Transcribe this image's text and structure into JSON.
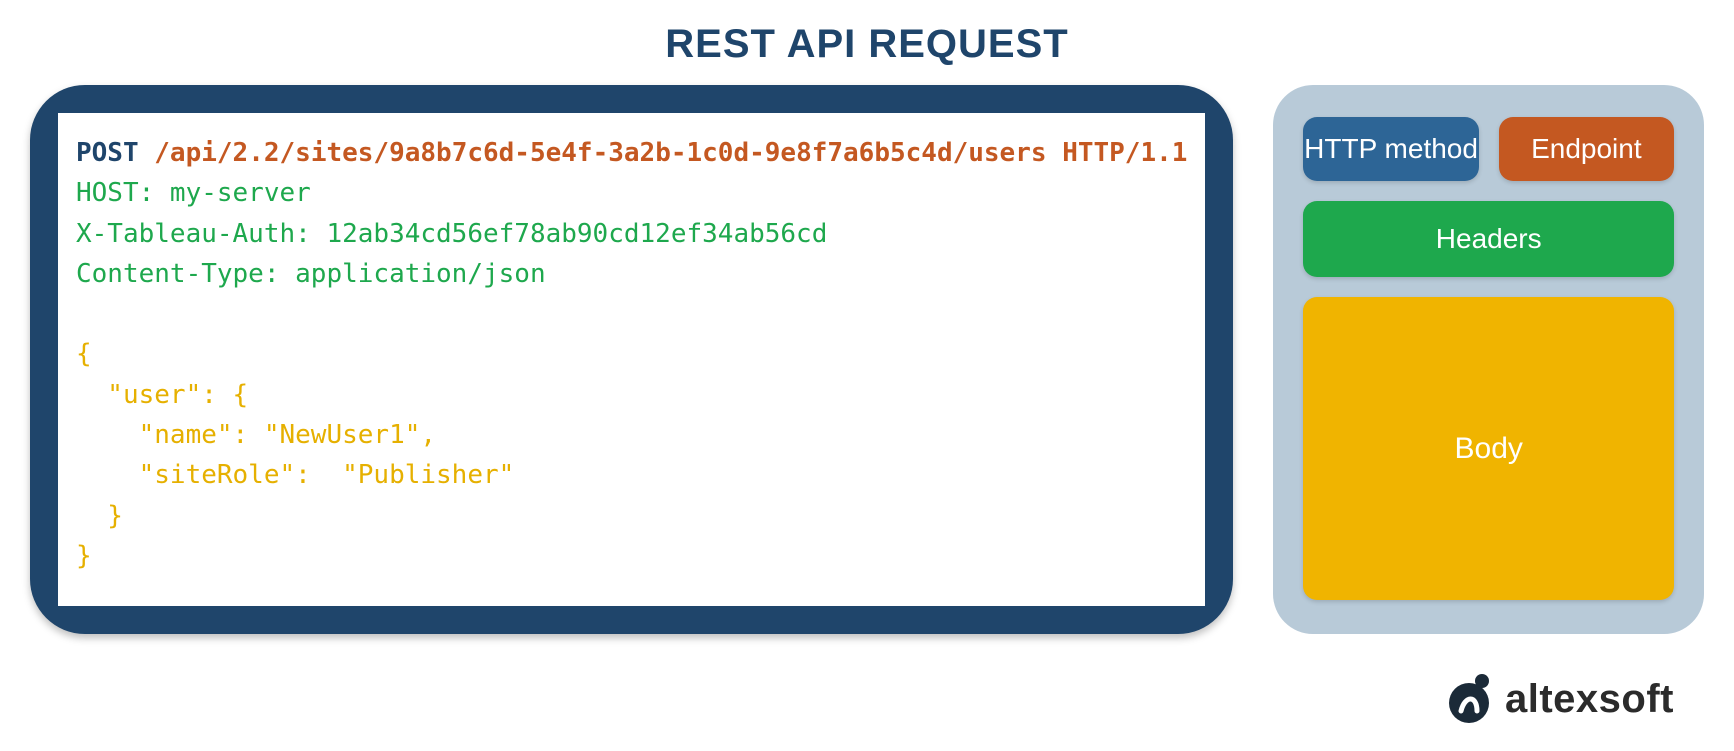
{
  "title": "REST API REQUEST",
  "request": {
    "method": "POST",
    "endpoint": "/api/2.2/sites/9a8b7c6d-5e4f-3a2b-1c0d-9e8f7a6b5c4d/users",
    "protocol": "HTTP/1.1",
    "headers": [
      "HOST: my-server",
      "X-Tableau-Auth: 12ab34cd56ef78ab90cd12ef34ab56cd",
      "Content-Type: application/json"
    ],
    "body_lines": [
      "{",
      "  \"user\": {",
      "    \"name\": \"NewUser1\",",
      "    \"siteRole\":  \"Publisher\"",
      "  }",
      "}"
    ]
  },
  "legend": {
    "method": "HTTP method",
    "endpoint": "Endpoint",
    "headers": "Headers",
    "body": "Body"
  },
  "brand": "altexsoft",
  "colors": {
    "title": "#1f456b",
    "code_card_bg": "#1f456b",
    "legend_card_bg": "#b8cad8",
    "chip_method": "#2d6596",
    "chip_endpoint": "#c45821",
    "chip_headers": "#1ea84d",
    "chip_body": "#f0b400",
    "text_method": "#1f456b",
    "text_endpoint": "#c45821",
    "text_header": "#1ea84d",
    "text_body": "#e6b000"
  }
}
